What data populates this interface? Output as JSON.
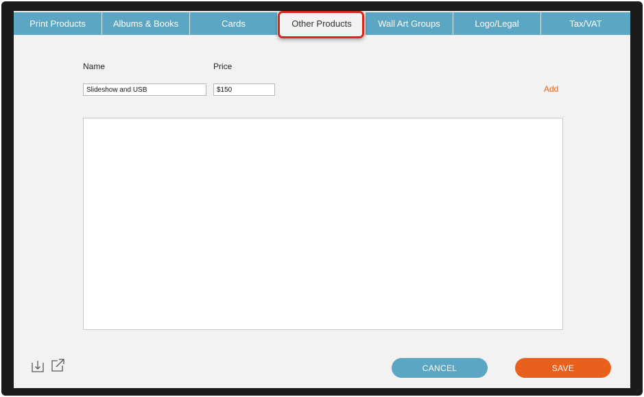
{
  "tabs": [
    {
      "label": "Print Products"
    },
    {
      "label": "Albums & Books"
    },
    {
      "label": "Cards"
    },
    {
      "label": "Other Products"
    },
    {
      "label": "Wall Art Groups"
    },
    {
      "label": "Logo/Legal"
    },
    {
      "label": "Tax/VAT"
    }
  ],
  "active_tab": "Other Products",
  "form": {
    "name_label": "Name",
    "price_label": "Price",
    "name_value": "Slideshow and USB",
    "price_value": "$150",
    "add_label": "Add"
  },
  "footer": {
    "import_icon": "import-icon",
    "export_icon": "export-icon",
    "cancel_label": "CANCEL",
    "save_label": "SAVE"
  },
  "colors": {
    "tab_bar": "#5ba6c3",
    "highlight": "#d9261c",
    "accent": "#e8601c",
    "cancel": "#5ba6c3"
  }
}
